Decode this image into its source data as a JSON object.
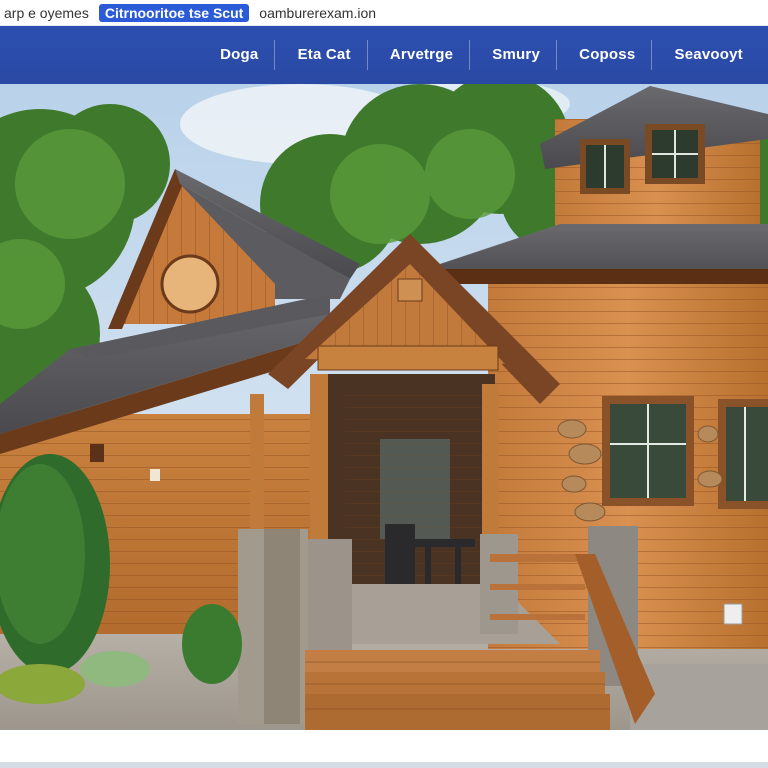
{
  "address_bar": {
    "left_text": "arp е oyemes",
    "highlighted_text": "Citrnooritoe tse  Scut",
    "right_text": "oamburerexam.ion"
  },
  "nav": {
    "items": [
      {
        "label": "Doga"
      },
      {
        "label": "Eta Cat"
      },
      {
        "label": "Arvetrge"
      },
      {
        "label": "Smury"
      },
      {
        "label": "Coposs"
      },
      {
        "label": "Seavooyt"
      }
    ]
  },
  "colors": {
    "nav_bg": "#2c4fb0",
    "url_highlight": "#2b5bd6"
  }
}
